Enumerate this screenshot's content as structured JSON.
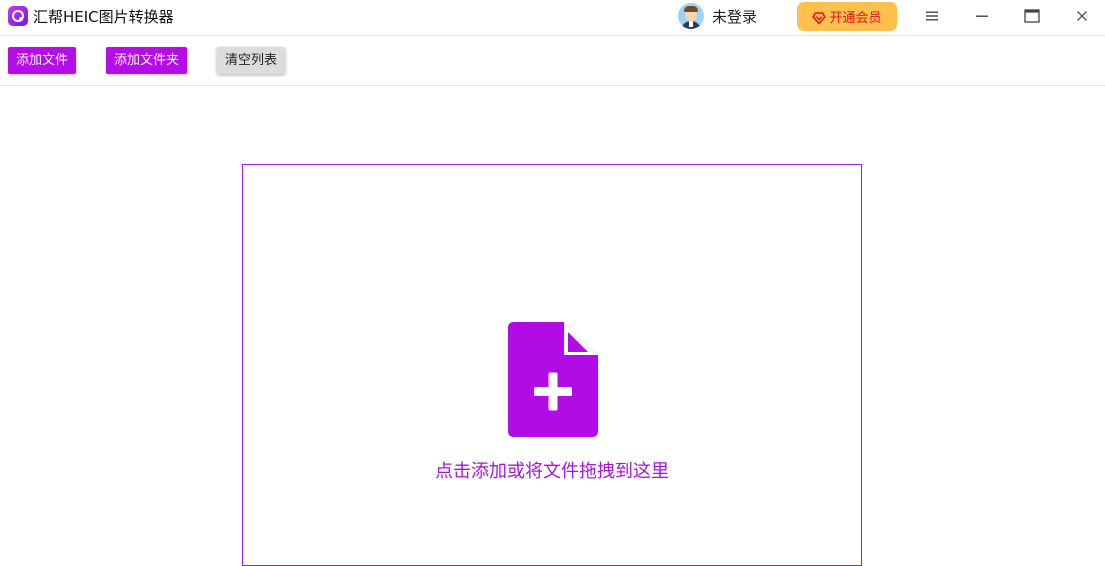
{
  "app": {
    "title": "汇帮HEIC图片转换器",
    "accent_color": "#b40de5"
  },
  "header": {
    "user_status": "未登录",
    "vip_button_label": "开通会员",
    "vip_button_color": "#ffc04d",
    "vip_text_color": "#e0141b",
    "controls": [
      {
        "name": "menu-icon"
      },
      {
        "name": "minimize-icon"
      },
      {
        "name": "maximize-icon"
      },
      {
        "name": "close-icon"
      }
    ]
  },
  "toolbar": {
    "add_file_label": "添加文件",
    "add_folder_label": "添加文件夹",
    "clear_list_label": "清空列表"
  },
  "dropzone": {
    "icon": "file-add-icon",
    "hint": "点击添加或将文件拖拽到这里"
  }
}
